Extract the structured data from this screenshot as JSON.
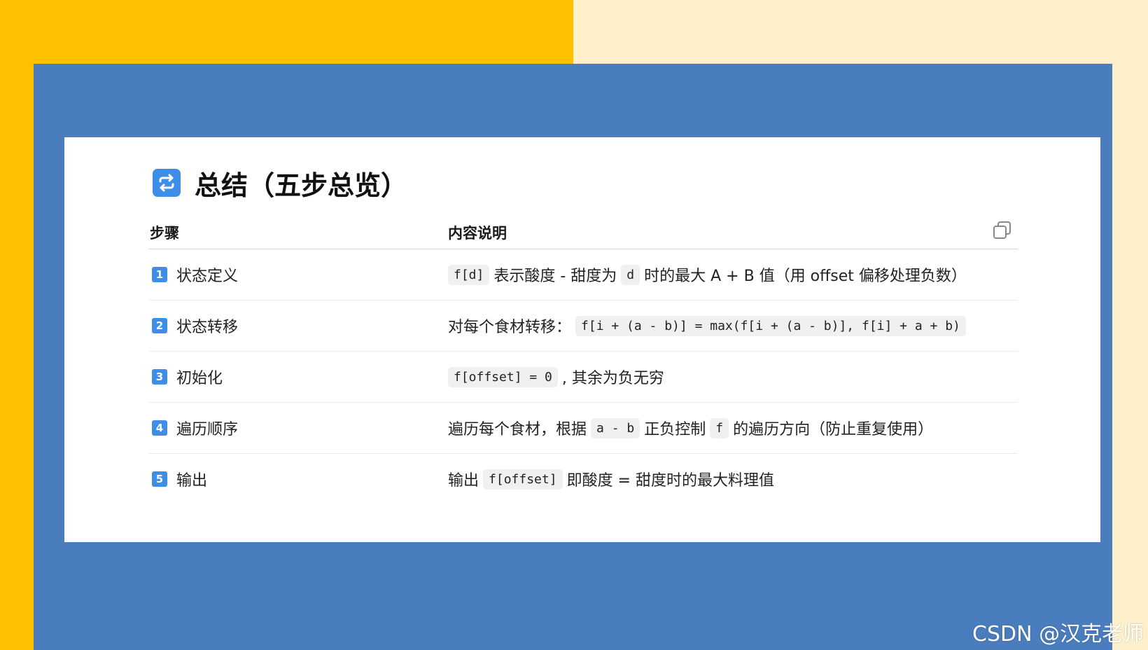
{
  "title": "总结（五步总览）",
  "table": {
    "headers": {
      "step": "步骤",
      "desc": "内容说明"
    },
    "rows": [
      {
        "num": "1",
        "step": "状态定义",
        "parts": [
          {
            "t": "code",
            "v": "f[d]"
          },
          {
            "t": "text",
            "v": "表示酸度 - 甜度为"
          },
          {
            "t": "code",
            "v": "d"
          },
          {
            "t": "text",
            "v": "时的最大 A + B 值（用 offset 偏移处理负数）"
          }
        ]
      },
      {
        "num": "2",
        "step": "状态转移",
        "parts": [
          {
            "t": "text",
            "v": "对每个食材转移："
          },
          {
            "t": "code",
            "v": "f[i + (a - b)] = max(f[i + (a - b)], f[i] + a + b)"
          }
        ]
      },
      {
        "num": "3",
        "step": "初始化",
        "parts": [
          {
            "t": "code",
            "v": "f[offset] = 0"
          },
          {
            "t": "text",
            "v": ", 其余为负无穷"
          }
        ]
      },
      {
        "num": "4",
        "step": "遍历顺序",
        "parts": [
          {
            "t": "text",
            "v": "遍历每个食材，根据"
          },
          {
            "t": "code",
            "v": "a - b"
          },
          {
            "t": "text",
            "v": "正负控制"
          },
          {
            "t": "code",
            "v": "f"
          },
          {
            "t": "text",
            "v": "的遍历方向（防止重复使用）"
          }
        ]
      },
      {
        "num": "5",
        "step": "输出",
        "parts": [
          {
            "t": "text",
            "v": "输出"
          },
          {
            "t": "code",
            "v": "f[offset]"
          },
          {
            "t": "text",
            "v": "即酸度 = 甜度时的最大料理值"
          }
        ]
      }
    ]
  },
  "watermark": "CSDN @汉克老师",
  "colors": {
    "yellow": "#FFC000",
    "cream": "#FFF0CC",
    "blue": "#4A7DBD",
    "accent": "#3E8EE8"
  },
  "icons": {
    "title": "repeat-icon",
    "copy": "copy-icon"
  }
}
